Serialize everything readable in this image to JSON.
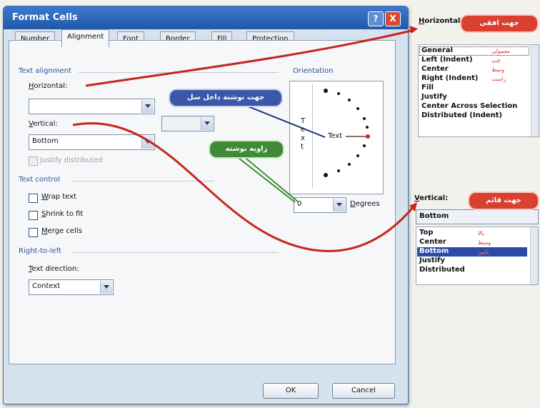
{
  "dialog": {
    "title": "Format Cells",
    "help_glyph": "?",
    "close_glyph": "X",
    "tabs": [
      {
        "label": "Number"
      },
      {
        "label": "Alignment"
      },
      {
        "label": "Font"
      },
      {
        "label": "Border"
      },
      {
        "label": "Fill"
      },
      {
        "label": "Protection"
      }
    ],
    "text_alignment": {
      "group_label": "Text alignment",
      "horizontal_label": "Horizontal:",
      "horizontal_value": "",
      "vertical_label": "Vertical:",
      "vertical_value": "Bottom",
      "justify_distributed": "Justify distributed"
    },
    "text_control": {
      "group_label": "Text control",
      "wrap_text": "Wrap text",
      "shrink_to_fit": "Shrink to fit",
      "merge_cells": "Merge cells"
    },
    "rtl": {
      "group_label": "Right-to-left",
      "text_direction_label": "Text direction:",
      "text_direction_value": "Context"
    },
    "orientation": {
      "label": "Orientation",
      "vertical_text": [
        "T",
        "e",
        "x",
        "t"
      ],
      "rotated_text": "Text",
      "degrees_value": "0",
      "degrees_label": "Degrees"
    },
    "buttons": {
      "ok": "OK",
      "cancel": "Cancel"
    }
  },
  "callouts": {
    "horizontal": "جهت افقی",
    "vertical": "جهت قائم",
    "text_direction": "جهت نوشته داخل سل",
    "text_angle": "زاویه نوشته"
  },
  "horizontal_panel": {
    "label": "Horizontal:",
    "options": [
      "General",
      "Left (Indent)",
      "Center",
      "Right (Indent)",
      "Fill",
      "Justify",
      "Center Across Selection",
      "Distributed (Indent)"
    ],
    "annotations": [
      "معمولی",
      "چپ",
      "وسط",
      "راست"
    ],
    "selected": "General"
  },
  "vertical_panel": {
    "label": "Vertical:",
    "value": "Bottom",
    "options": [
      "Top",
      "Center",
      "Bottom",
      "Justify",
      "Distributed"
    ],
    "annotations": [
      "بالا",
      "وسط",
      "پایین"
    ],
    "selected": "Bottom"
  },
  "colors": {
    "title_bar": "#1f58a9",
    "callout_red": "#d9402f",
    "callout_blue": "#3c57a8",
    "callout_green": "#3f8a35",
    "arrow_red": "#c4261e",
    "selection": "#2b4aa8"
  }
}
